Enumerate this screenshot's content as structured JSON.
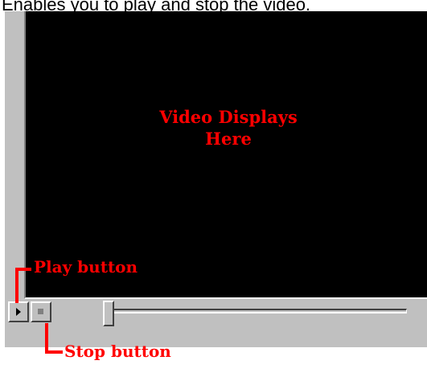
{
  "caption": "Enables you to play and stop the video.",
  "video": {
    "placeholder_line1": "Video Displays",
    "placeholder_line2": "Here"
  },
  "controls": {
    "play_label": "Play button",
    "stop_label": "Stop button",
    "play_icon": "play-icon",
    "stop_icon": "stop-icon"
  },
  "seek": {
    "position_fraction": 0.0
  },
  "colors": {
    "annotation": "#ff0000",
    "video_background": "#000000",
    "panel": "#c0c0c0"
  }
}
